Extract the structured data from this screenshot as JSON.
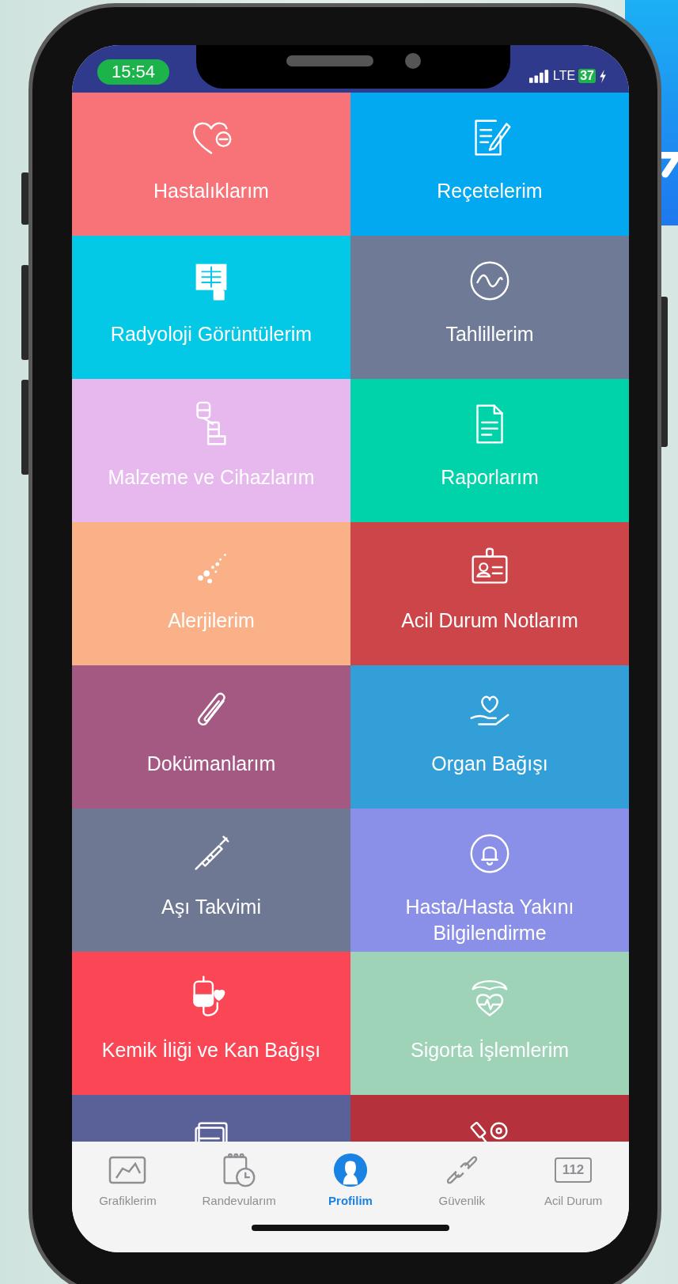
{
  "status_bar": {
    "time": "15:54",
    "network": "LTE",
    "battery": "37"
  },
  "tiles": [
    {
      "label": "Hastalıklarım",
      "color": "#f87378"
    },
    {
      "label": "Reçetelerim",
      "color": "#03a9f0"
    },
    {
      "label": "Radyoloji Görüntülerim",
      "color": "#04c9e6"
    },
    {
      "label": "Tahlillerim",
      "color": "#6e7a96"
    },
    {
      "label": "Malzeme ve Cihazlarım",
      "color": "#e6b8ee"
    },
    {
      "label": "Raporlarım",
      "color": "#00d3aa"
    },
    {
      "label": "Alerjilerim",
      "color": "#fbb187"
    },
    {
      "label": "Acil Durum Notlarım",
      "color": "#cc4549"
    },
    {
      "label": "Dokümanlarım",
      "color": "#a45982"
    },
    {
      "label": "Organ Bağışı",
      "color": "#339fd9"
    },
    {
      "label": "Aşı Takvimi",
      "color": "#6e7893"
    },
    {
      "label": "Hasta/Hasta Yakını Bilgilendirme",
      "color": "#8a8fe8"
    },
    {
      "label": "Kemik İliği ve Kan Bağışı",
      "color": "#fb4656"
    },
    {
      "label": "Sigorta İşlemlerim",
      "color": "#9ed3b8"
    },
    {
      "color": "#5a6199"
    },
    {
      "color": "#b5313c"
    }
  ],
  "tab_bar": [
    {
      "label": "Grafiklerim",
      "selected": false
    },
    {
      "label": "Randevularım",
      "selected": false
    },
    {
      "label": "Profilim",
      "selected": true
    },
    {
      "label": "Güvenlik",
      "selected": false
    },
    {
      "label": "Acil Durum",
      "selected": false,
      "badge": "112"
    }
  ]
}
